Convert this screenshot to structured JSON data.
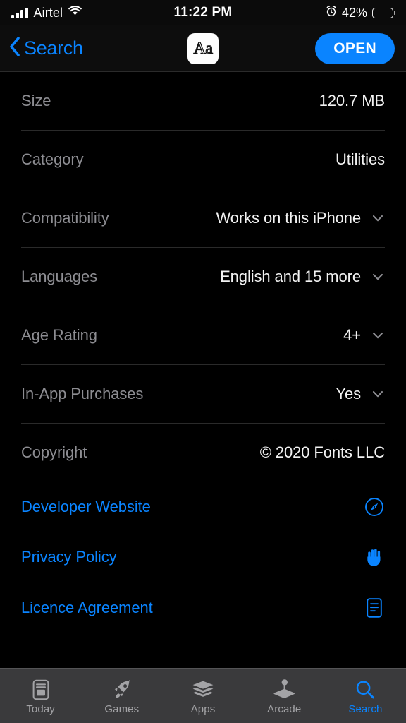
{
  "status_bar": {
    "carrier": "Airtel",
    "signal_icon": "signal-bars-icon",
    "wifi_icon": "wifi-icon",
    "time": "11:22 PM",
    "alarm_icon": "alarm-clock-icon",
    "battery_percent": "42%",
    "battery_level": 42,
    "battery_icon": "battery-icon"
  },
  "nav_bar": {
    "back_label": "Search",
    "back_icon": "chevron-left-icon",
    "app_icon_glyph": "Aa",
    "app_icon_name": "app-icon-fonts",
    "open_label": "OPEN",
    "accent_color": "#0a84ff"
  },
  "info_rows": [
    {
      "label": "Size",
      "value": "120.7 MB",
      "chevron": false
    },
    {
      "label": "Category",
      "value": "Utilities",
      "chevron": false
    },
    {
      "label": "Compatibility",
      "value": "Works on this iPhone",
      "chevron": true
    },
    {
      "label": "Languages",
      "value": "English and 15 more",
      "chevron": true
    },
    {
      "label": "Age Rating",
      "value": "4+",
      "chevron": true
    },
    {
      "label": "In-App Purchases",
      "value": "Yes",
      "chevron": true
    },
    {
      "label": "Copyright",
      "value": "© 2020 Fonts LLC",
      "chevron": false
    }
  ],
  "link_rows": [
    {
      "label": "Developer Website",
      "icon": "safari-compass-icon"
    },
    {
      "label": "Privacy Policy",
      "icon": "raised-hand-icon"
    },
    {
      "label": "Licence Agreement",
      "icon": "document-icon"
    }
  ],
  "tab_bar": {
    "items": [
      {
        "label": "Today",
        "icon": "today-newspaper-icon",
        "active": false
      },
      {
        "label": "Games",
        "icon": "rocket-icon",
        "active": false
      },
      {
        "label": "Apps",
        "icon": "stacked-layers-icon",
        "active": false
      },
      {
        "label": "Arcade",
        "icon": "joystick-icon",
        "active": false
      },
      {
        "label": "Search",
        "icon": "magnifier-icon",
        "active": true
      }
    ],
    "active_color": "#0a84ff",
    "inactive_color": "#a3a3a6"
  }
}
